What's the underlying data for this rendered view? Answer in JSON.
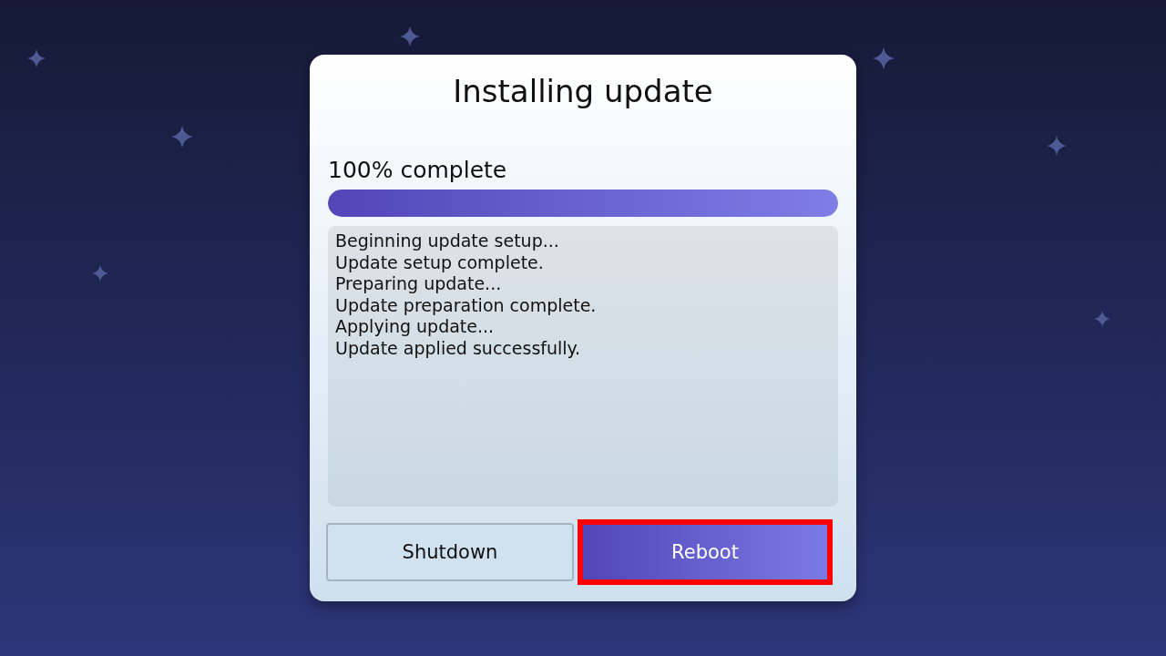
{
  "dialog": {
    "title": "Installing update",
    "progress": {
      "label": "100% complete",
      "level": 1
    },
    "log": [
      "Beginning update setup...",
      "Update setup complete.",
      "Preparing update...",
      "Update preparation complete.",
      "Applying update...",
      "Update applied successfully."
    ],
    "buttons": [
      {
        "label": "Shutdown",
        "selected": false
      },
      {
        "label": "Reboot",
        "selected": true
      }
    ]
  }
}
